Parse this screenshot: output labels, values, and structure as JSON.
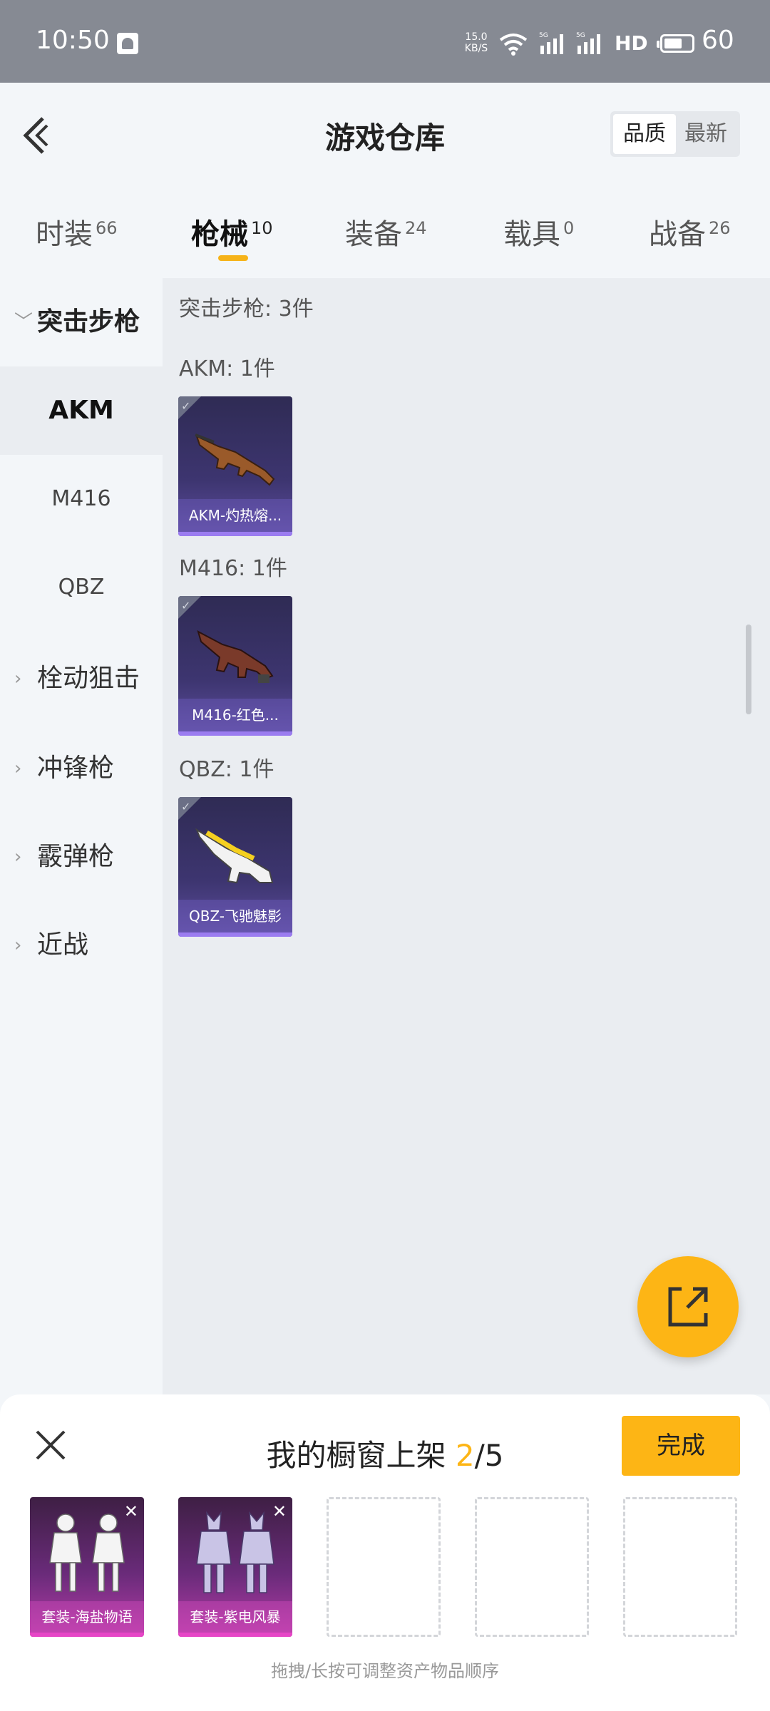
{
  "status_bar": {
    "time": "10:50",
    "net_speed_value": "15.0",
    "net_speed_unit": "KB/S",
    "network_hd": "HD",
    "battery": "60"
  },
  "header": {
    "title": "游戏仓库",
    "sort_options": [
      "品质",
      "最新"
    ],
    "sort_selected": "品质"
  },
  "tabs": [
    {
      "label": "时装",
      "count": "66"
    },
    {
      "label": "枪械",
      "count": "10",
      "active": true
    },
    {
      "label": "装备",
      "count": "24"
    },
    {
      "label": "载具",
      "count": "0"
    },
    {
      "label": "战备",
      "count": "26"
    }
  ],
  "sidebar": {
    "open_category": "突击步枪",
    "sub_items": [
      "AKM",
      "M416",
      "QBZ"
    ],
    "active_sub": "AKM",
    "other_categories": [
      "栓动狙击",
      "冲锋枪",
      "霰弹枪",
      "近战"
    ]
  },
  "content": {
    "section_header": "突击步枪: 3件",
    "groups": [
      {
        "header": "AKM: 1件",
        "item_name": "AKM-灼热熔...",
        "icon": "rifle-akm-icon"
      },
      {
        "header": "M416: 1件",
        "item_name": "M416-红色...",
        "icon": "rifle-m416-icon"
      },
      {
        "header": "QBZ: 1件",
        "item_name": "QBZ-飞驰魅影",
        "icon": "rifle-qbz-icon"
      }
    ]
  },
  "showcase": {
    "title_prefix": "我的橱窗上架 ",
    "count_current": "2",
    "count_total": "/5",
    "done_label": "完成",
    "slots": [
      {
        "name": "套装-海盐物语",
        "filled": true
      },
      {
        "name": "套装-紫电风暴",
        "filled": true
      },
      {
        "name": "",
        "filled": false
      },
      {
        "name": "",
        "filled": false
      },
      {
        "name": "",
        "filled": false
      }
    ],
    "hint": "拖拽/长按可调整资产物品顺序"
  },
  "colors": {
    "accent": "#fdb515",
    "card_gradient_top": "#2f2b54",
    "card_gradient_bottom": "#5e4e9e",
    "outfit_gradient_bottom": "#b43ca6"
  }
}
